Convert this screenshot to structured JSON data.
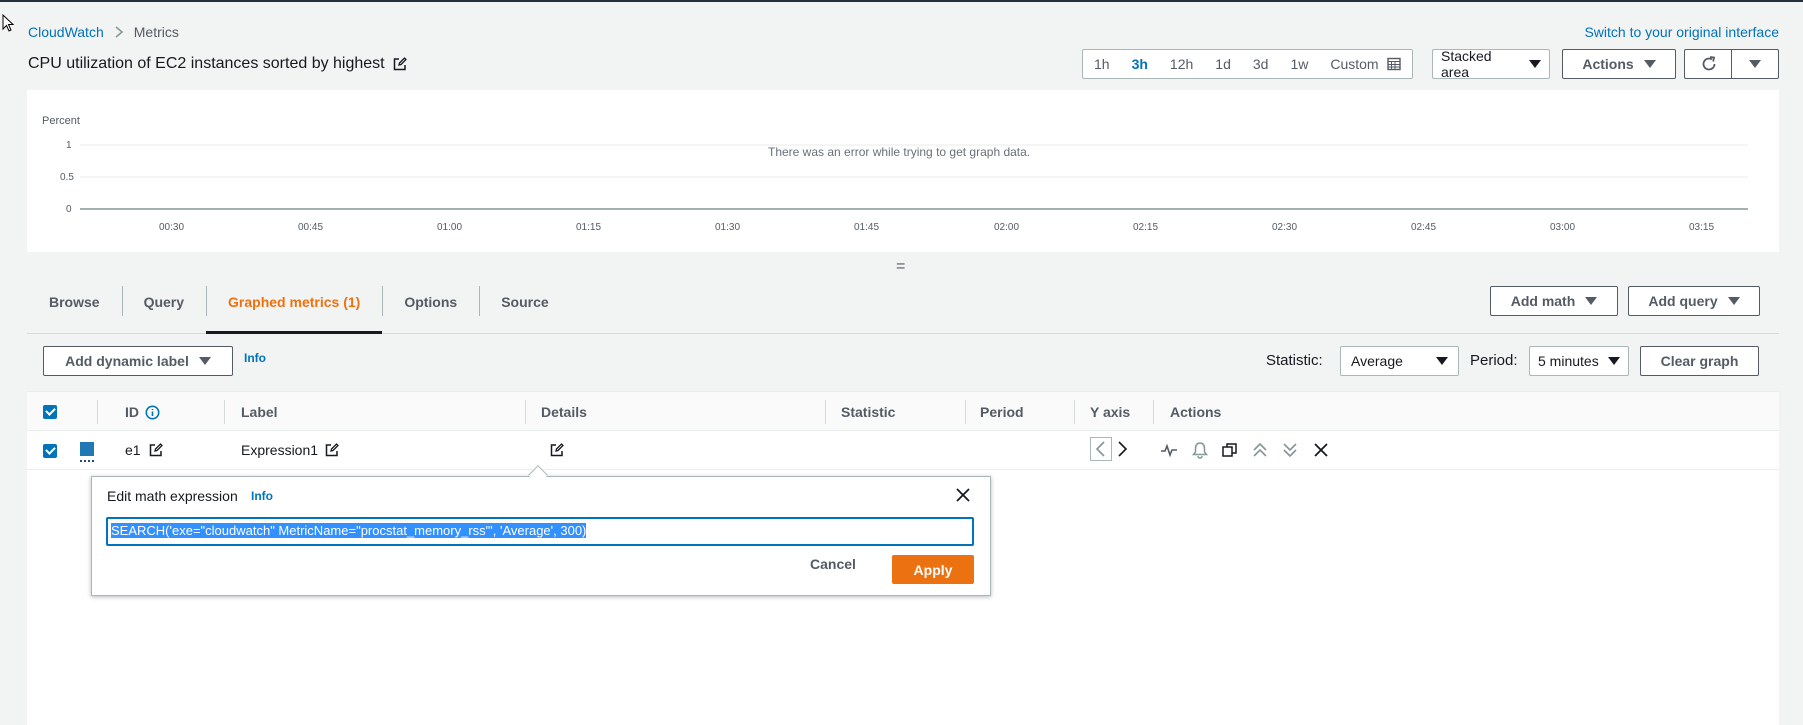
{
  "breadcrumb": {
    "root": "CloudWatch",
    "current": "Metrics"
  },
  "header": {
    "switch_link": "Switch to your original interface",
    "title": "CPU utilization of EC2 instances sorted by highest",
    "time_ranges": [
      {
        "label": "1h",
        "active": false
      },
      {
        "label": "3h",
        "active": true
      },
      {
        "label": "12h",
        "active": false
      },
      {
        "label": "1d",
        "active": false
      },
      {
        "label": "3d",
        "active": false
      },
      {
        "label": "1w",
        "active": false
      },
      {
        "label": "Custom",
        "active": false
      }
    ],
    "chart_type": "Stacked area",
    "actions_label": "Actions"
  },
  "graph": {
    "y_unit": "Percent",
    "y_ticks": [
      "1",
      "0.5",
      "0"
    ],
    "x_ticks": [
      "00:30",
      "00:45",
      "01:00",
      "01:15",
      "01:30",
      "01:45",
      "02:00",
      "02:15",
      "02:30",
      "02:45",
      "03:00",
      "03:15"
    ],
    "error": "There was an error while trying to get graph data.",
    "resize_handle": "="
  },
  "tabs": [
    {
      "label": "Browse",
      "active": false
    },
    {
      "label": "Query",
      "active": false
    },
    {
      "label": "Graphed metrics (1)",
      "active": true
    },
    {
      "label": "Options",
      "active": false
    },
    {
      "label": "Source",
      "active": false
    }
  ],
  "tab_actions": {
    "add_math": "Add math",
    "add_query": "Add query"
  },
  "toolbar": {
    "dynamic_label": "Add dynamic label",
    "info": "Info",
    "statistic_label": "Statistic:",
    "statistic_value": "Average",
    "period_label": "Period:",
    "period_value": "5 minutes",
    "clear_graph": "Clear graph"
  },
  "table": {
    "headers": [
      "ID",
      "Label",
      "Details",
      "Statistic",
      "Period",
      "Y axis",
      "Actions"
    ],
    "rows": [
      {
        "id": "e1",
        "label": "Expression1",
        "color": "#1f77b4",
        "checked": true
      }
    ]
  },
  "popover": {
    "title": "Edit math expression",
    "info": "Info",
    "expression": "SEARCH('exe=\"cloudwatch\" MetricName=\"procstat_memory_rss\"', 'Average', 300)",
    "cancel": "Cancel",
    "apply": "Apply"
  },
  "colors": {
    "link": "#0073bb",
    "accent": "#ec7211",
    "series": "#1f77b4"
  }
}
